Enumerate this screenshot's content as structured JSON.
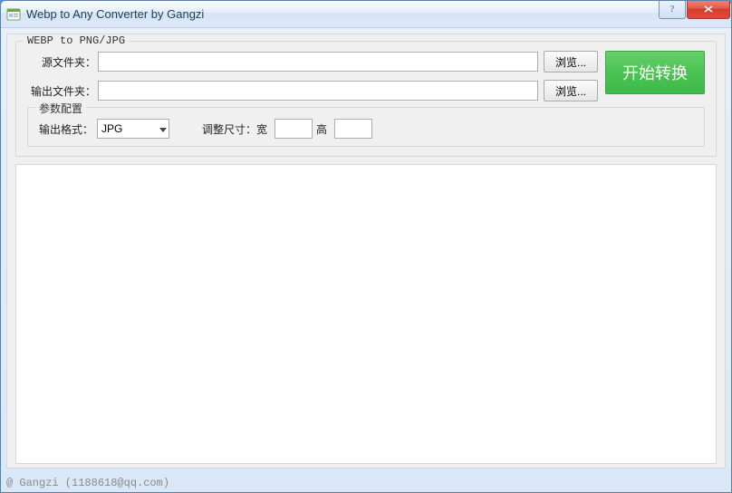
{
  "window": {
    "title": "Webp to Any Converter by Gangzi"
  },
  "group": {
    "title": "WEBP to PNG/JPG",
    "source_label": "源文件夹：",
    "source_value": "",
    "output_label": "输出文件夹：",
    "output_value": "",
    "browse_label": "浏览...",
    "start_label": "开始转换"
  },
  "params": {
    "title": "参数配置",
    "format_label": "输出格式：",
    "format_value": "JPG",
    "resize_label": "调整尺寸：宽",
    "width_value": "",
    "height_label": "高",
    "height_value": ""
  },
  "status": {
    "text": "@ Gangzi (1188618@qq.com)"
  }
}
